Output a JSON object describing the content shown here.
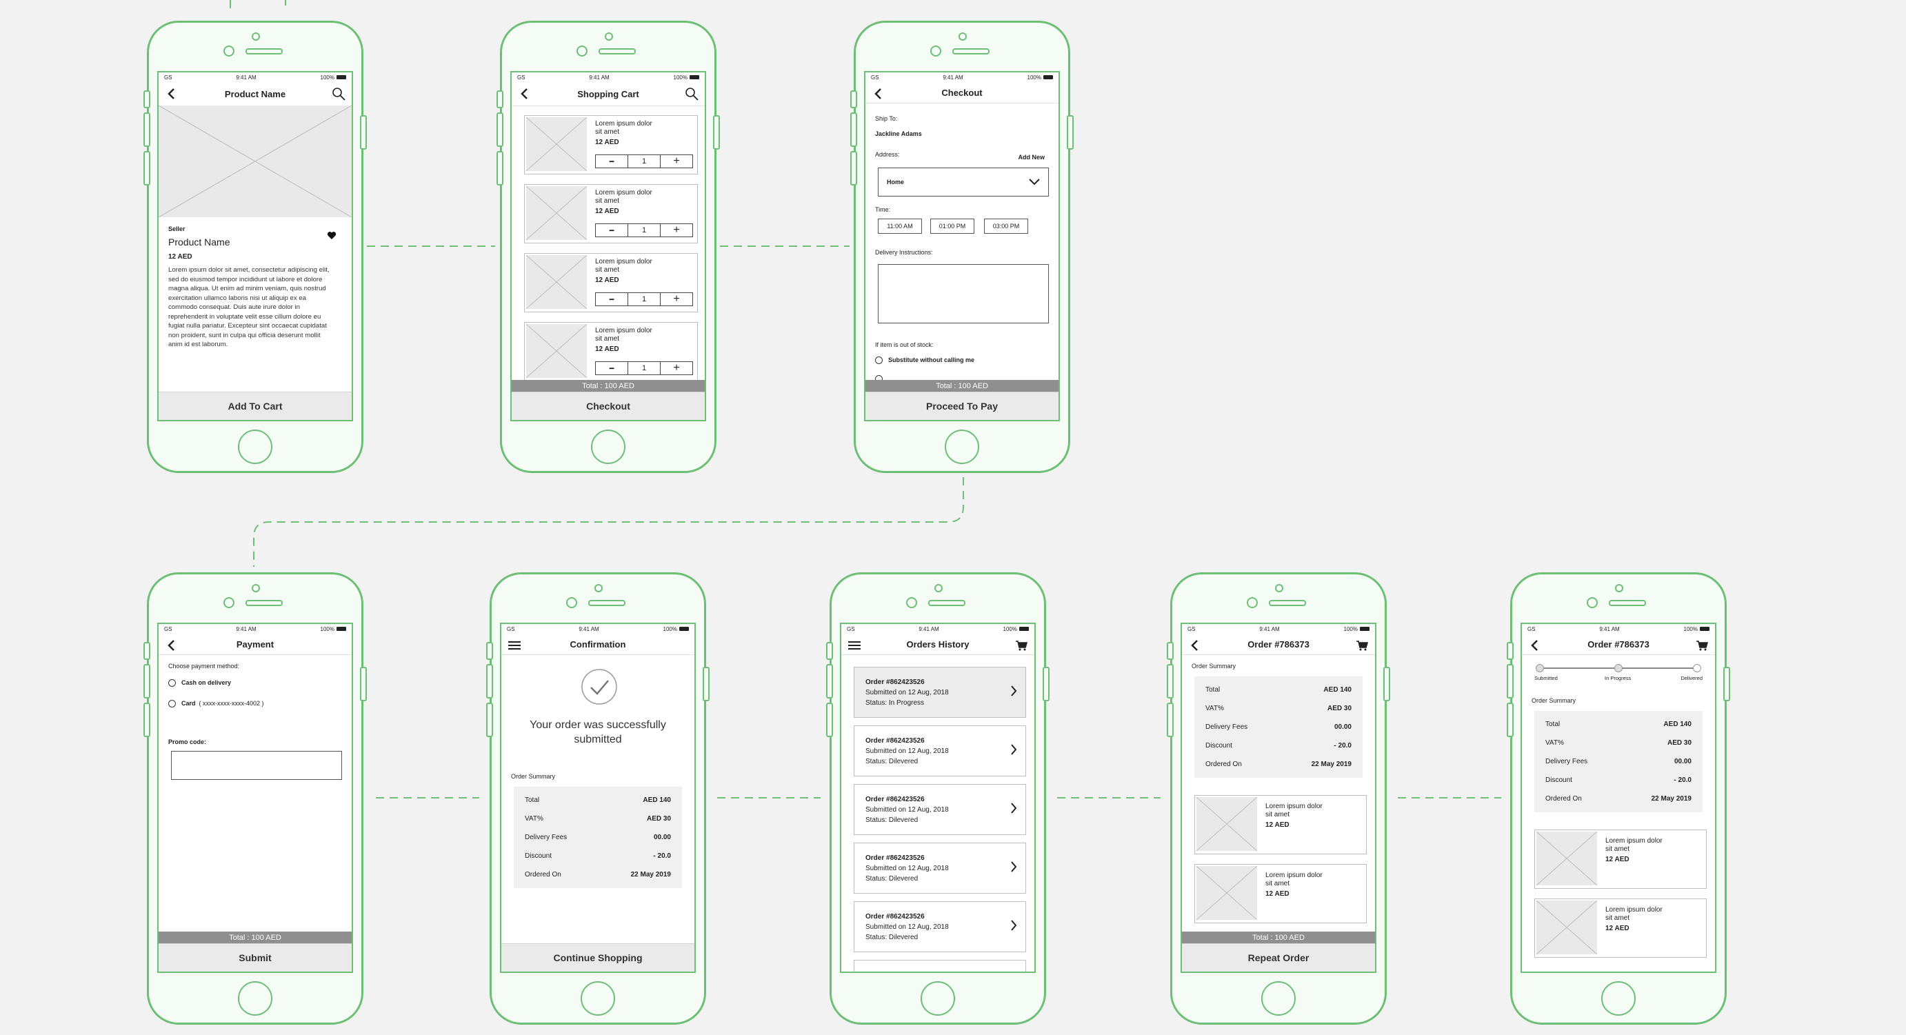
{
  "status": {
    "carrier": "GS",
    "time": "9:41 AM",
    "battery": "100%"
  },
  "product": {
    "nav_title": "Product Name",
    "seller_label": "Seller",
    "name": "Product Name",
    "price": "12 AED",
    "description": "Lorem ipsum dolor sit amet, consectetur adipiscing elit, sed do eiusmod tempor incididunt ut labore et dolore magna aliqua. Ut enim ad minim veniam, quis nostrud exercitation ullamco laboris nisi ut aliquip ex ea commodo consequat. Duis aute irure dolor in reprehenderit in voluptate velit esse cillum dolore eu fugiat nulla pariatur. Excepteur sint occaecat cupidatat non proident, sunt in culpa qui officia deserunt mollit anim id est laborum.",
    "button": "Add To Cart"
  },
  "cart": {
    "nav_title": "Shopping Cart",
    "item_text_1": "Lorem ipsum dolor",
    "item_text_2": "sit amet",
    "item_price": "12 AED",
    "qty": "1",
    "total": "Total : 100 AED",
    "button": "Checkout"
  },
  "checkout": {
    "nav_title": "Checkout",
    "ship_to_label": "Ship To:",
    "ship_to_name": "Jackline Adams",
    "address_label": "Address:",
    "add_new": "Add New",
    "address_value": "Home",
    "time_label": "Time:",
    "times": [
      "11:00 AM",
      "01:00 PM",
      "03:00 PM"
    ],
    "instructions_label": "Delivery Instructions:",
    "stock_label": "If item is out of stock:",
    "option_1": "Substitute without calling me",
    "total": "Total : 100 AED",
    "button": "Proceed To Pay"
  },
  "payment": {
    "nav_title": "Payment",
    "choose_label": "Choose payment method:",
    "option_cash": "Cash on delivery",
    "option_card": "Card",
    "card_number": "( xxxx-xxxx-xxxx-4002 )",
    "promo_label": "Promo code:",
    "total": "Total : 100 AED",
    "button": "Submit"
  },
  "confirmation": {
    "nav_title": "Confirmation",
    "message": "Your order was successfully submitted",
    "summary_label": "Order Summary",
    "button": "Continue Shopping"
  },
  "summary": {
    "rows": [
      {
        "label": "Total",
        "value": "AED 140"
      },
      {
        "label": "VAT%",
        "value": "AED 30"
      },
      {
        "label": "Delivery Fees",
        "value": "00.00"
      },
      {
        "label": "Discount",
        "value": "- 20.0"
      },
      {
        "label": "Ordered On",
        "value": "22 May 2019"
      }
    ]
  },
  "history": {
    "nav_title": "Orders History",
    "order_id": "Order #862423526",
    "submitted": "Submitted on 12 Aug, 2018",
    "status_in_progress": "Status: In Progress",
    "status_delivered": "Status: Dilevered"
  },
  "order_detail": {
    "nav_title": "Order #786373",
    "summary_label": "Order Summary",
    "total": "Total : 100 AED",
    "button": "Repeat Order",
    "steps": [
      "Submitted",
      "In Progress",
      "Delivered"
    ],
    "progress": 1.0
  }
}
